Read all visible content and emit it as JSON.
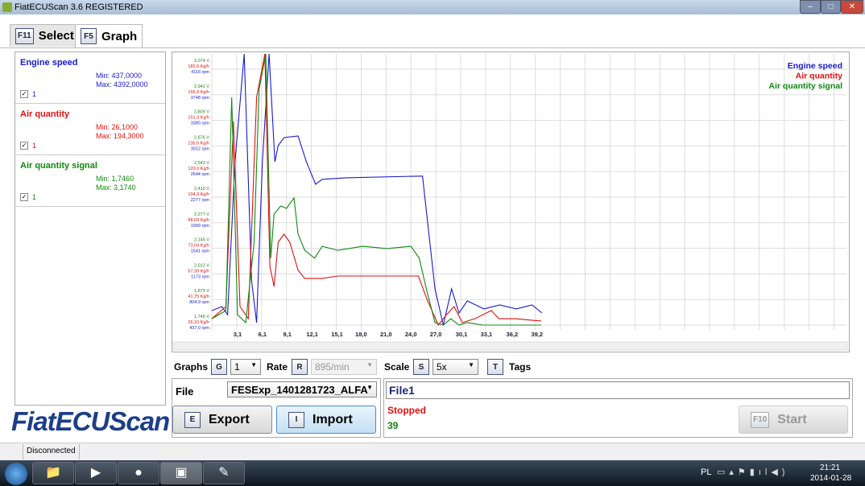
{
  "window": {
    "title": "FiatECUScan 3.6 REGISTERED"
  },
  "tabs": [
    {
      "key": "F11",
      "label": "Select"
    },
    {
      "key": "F5",
      "label": "Graph"
    }
  ],
  "signals": [
    {
      "name": "Engine speed",
      "min": "Min: 437,0000",
      "max": "Max: 4392,0000",
      "checked": true,
      "check_label": "1",
      "color": "#1a1acc"
    },
    {
      "name": "Air quantity",
      "min": "Min: 26,1000",
      "max": "Max: 194,3000",
      "checked": true,
      "check_label": "1",
      "color": "#dd1111"
    },
    {
      "name": "Air quantity signal",
      "min": "Min: 1,7460",
      "max": "Max: 3,1740",
      "checked": true,
      "check_label": "1",
      "color": "#118811"
    }
  ],
  "logo": "FiatECUScan",
  "controls": {
    "graphs_label": "Graphs",
    "graphs_key": "G",
    "graphs_value": "1",
    "rate_label": "Rate",
    "rate_key": "R",
    "rate_value": "895/min",
    "scale_label": "Scale",
    "scale_key": "S",
    "scale_value": "5x",
    "tags_key": "T",
    "tags_label": "Tags",
    "file_label": "File",
    "file_value": "FESExp_1401281723_ALFA",
    "file_name": "File1",
    "export_key": "E",
    "export_label": "Export",
    "import_key": "I",
    "import_label": "Import",
    "status_text": "Stopped",
    "status_count": "39",
    "start_key": "F10",
    "start_label": "Start"
  },
  "statusbar": {
    "text": "Disconnected"
  },
  "tray": {
    "lang": "PL",
    "time": "21:21",
    "date": "2014-01-28"
  },
  "chart_data": {
    "type": "line",
    "x_ticks": [
      "3,1",
      "6,1",
      "9,1",
      "12,1",
      "15,1",
      "18,0",
      "21,0",
      "24,0",
      "27,0",
      "30,1",
      "33,1",
      "36,2",
      "39,2"
    ],
    "x_tick_values": [
      3.1,
      6.1,
      9.1,
      12.1,
      15.1,
      18.0,
      21.0,
      24.0,
      27.0,
      30.1,
      33.1,
      36.2,
      39.2
    ],
    "y_ticks": [
      {
        "v": "3,074 V",
        "k": "182,6 Kg/h",
        "r": "4116 rpm"
      },
      {
        "v": "2,942 V",
        "k": "166,9 Kg/h",
        "r": "3748 rpm"
      },
      {
        "v": "2,809 V",
        "k": "151,3 Kg/h",
        "r": "3380 rpm"
      },
      {
        "v": "2,676 V",
        "k": "135,6 Kg/h",
        "r": "3012 rpm"
      },
      {
        "v": "2,543 V",
        "k": "120,0 Kg/h",
        "r": "2644 rpm"
      },
      {
        "v": "2,410 V",
        "k": "104,3 Kg/h",
        "r": "2277 rpm"
      },
      {
        "v": "2,277 V",
        "k": "88,69 Kg/h",
        "r": "1909 rpm"
      },
      {
        "v": "2,145 V",
        "k": "73,04 Kg/h",
        "r": "1541 rpm"
      },
      {
        "v": "2,012 V",
        "k": "57,39 Kg/h",
        "r": "1173 rpm"
      },
      {
        "v": "1,879 V",
        "k": "41,75 Kg/h",
        "r": "804,9 rpm"
      },
      {
        "v": "1,746 V",
        "k": "26,10 Kg/h",
        "r": "437,0 rpm"
      }
    ],
    "legend_position": "top-right",
    "series": [
      {
        "name": "Engine speed",
        "color": "#1a1acc",
        "min": 437,
        "max": 4116,
        "x": [
          0,
          1.2,
          1.9,
          2.8,
          3.9,
          4.8,
          5.4,
          6.1,
          6.9,
          7.6,
          8.0,
          8.7,
          10.4,
          11.4,
          12.5,
          13.3,
          16.2,
          24.9,
          25.4,
          26.9,
          27.9,
          28.9,
          29.8,
          30.8,
          32.8,
          34.7,
          36.7,
          38.6,
          39.8
        ],
        "y": [
          645,
          703,
          587,
          2786,
          4392,
          1072,
          472,
          2786,
          4392,
          2786,
          3017,
          3133,
          3156,
          2786,
          2462,
          2532,
          2555,
          2578,
          2578,
          958,
          437,
          958,
          611,
          784,
          669,
          726,
          669,
          726,
          611
        ]
      },
      {
        "name": "Air quantity",
        "color": "#dd1111",
        "min": 26.1,
        "max": 182.6,
        "x": [
          0,
          1.7,
          2.6,
          3.4,
          4.4,
          5.4,
          6.4,
          7.0,
          7.5,
          8.0,
          8.7,
          9.4,
          10.4,
          11.2,
          13.3,
          15.2,
          24.9,
          25.9,
          27.3,
          28.3,
          29.2,
          30.2,
          31.7,
          33.7,
          34.6,
          36.6,
          38.5,
          39.7
        ],
        "y": [
          30.0,
          37.4,
          150.6,
          37.4,
          30.0,
          165.4,
          194.3,
          62.0,
          49.7,
          76.8,
          81.7,
          76.8,
          59.6,
          54.6,
          54.6,
          56.1,
          56.1,
          42.3,
          26.1,
          32.5,
          37.4,
          27.6,
          30.0,
          35.0,
          30.0,
          30.0,
          29.1,
          28.6
        ]
      },
      {
        "name": "Air quantity signal",
        "color": "#118811",
        "min": 1.746,
        "max": 3.074,
        "x": [
          0,
          1.7,
          2.4,
          3.1,
          4.1,
          5.1,
          5.7,
          6.5,
          7.1,
          7.5,
          8.3,
          9.0,
          9.9,
          10.4,
          11.2,
          12.4,
          13.3,
          15.2,
          18.2,
          21.1,
          24.0,
          25.0,
          25.9,
          26.9,
          27.9,
          28.8,
          29.8,
          30.8,
          32.7,
          36.6,
          39.7
        ],
        "y": [
          1.779,
          1.821,
          2.928,
          1.8,
          1.759,
          2.176,
          2.97,
          3.174,
          2.093,
          2.322,
          2.364,
          2.352,
          2.406,
          2.218,
          2.134,
          2.093,
          2.155,
          2.134,
          2.155,
          2.143,
          2.155,
          2.093,
          1.926,
          1.759,
          1.746,
          1.779,
          1.746,
          1.759,
          1.746,
          1.746,
          1.746
        ]
      }
    ]
  }
}
